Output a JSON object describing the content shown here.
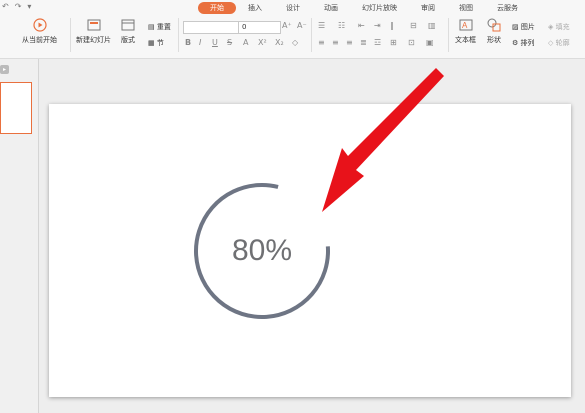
{
  "ribbon": {
    "tabs": [
      "开始",
      "插入",
      "设计",
      "动画",
      "幻灯片放映",
      "审阅",
      "视图",
      "云服务"
    ],
    "active_tab": "开始",
    "from_current": "从当前开始",
    "new_slide": "新建幻灯片",
    "layout": "版式",
    "reset": "重置",
    "section": "节",
    "font_name": "",
    "font_size": "0",
    "textbox": "文本框",
    "shape": "形状",
    "picture": "图片",
    "arrange": "排列",
    "fill": "填充",
    "outline": "轮廓"
  },
  "slide": {
    "progress_text": "80%",
    "progress_value": 0.8
  },
  "colors": {
    "accent": "#e9703e",
    "ring": "#6e7584",
    "arrow": "#e8121a"
  }
}
